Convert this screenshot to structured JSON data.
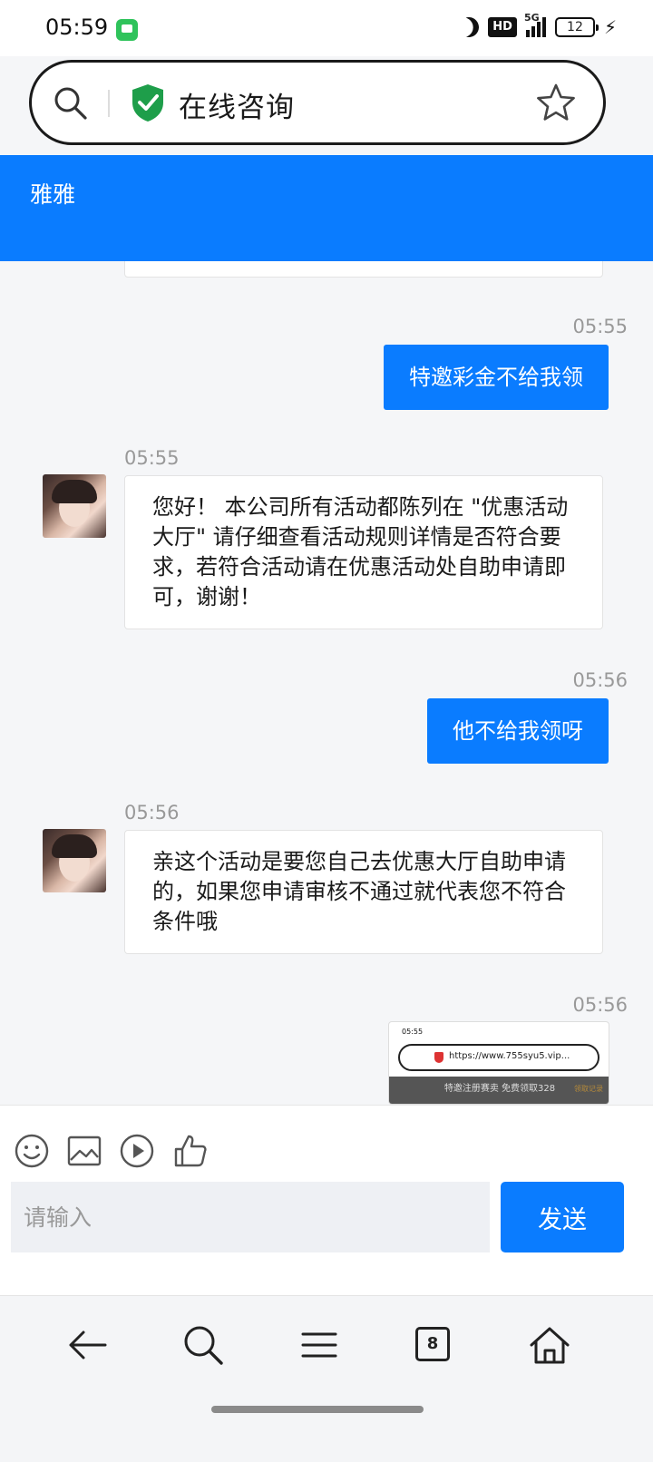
{
  "status_bar": {
    "time": "05:59",
    "network": "5G",
    "hd": "HD",
    "battery": "12"
  },
  "address_bar": {
    "title": "在线咨询"
  },
  "chat": {
    "agent_name": "雅雅",
    "messages": [
      {
        "direction": "out",
        "time": "05:55",
        "text": "特邀彩金不给我领"
      },
      {
        "direction": "in",
        "time": "05:55",
        "text": "您好！ 本公司所有活动都陈列在 \"优惠活动大厅\" 请仔细查看活动规则详情是否符合要求，若符合活动请在优惠活动处自助申请即可，谢谢！"
      },
      {
        "direction": "out",
        "time": "05:56",
        "text": "他不给我领呀"
      },
      {
        "direction": "in",
        "time": "05:56",
        "text": "亲这个活动是要您自己去优惠大厅自助申请的，如果您申请审核不通过就代表您不符合条件哦"
      },
      {
        "direction": "out",
        "time": "05:56",
        "type": "image"
      }
    ],
    "screenshot_thumb": {
      "time": "05:55",
      "url": "https://www.755syu5.vip...",
      "header": "特邀注册赛卖 免费领取328",
      "header_right": "领取记录"
    }
  },
  "composer": {
    "placeholder": "请输入",
    "send_label": "发送"
  },
  "navbar": {
    "tab_count": "8"
  },
  "colors": {
    "accent": "#0a7cff",
    "shield": "#1e9e4a"
  }
}
